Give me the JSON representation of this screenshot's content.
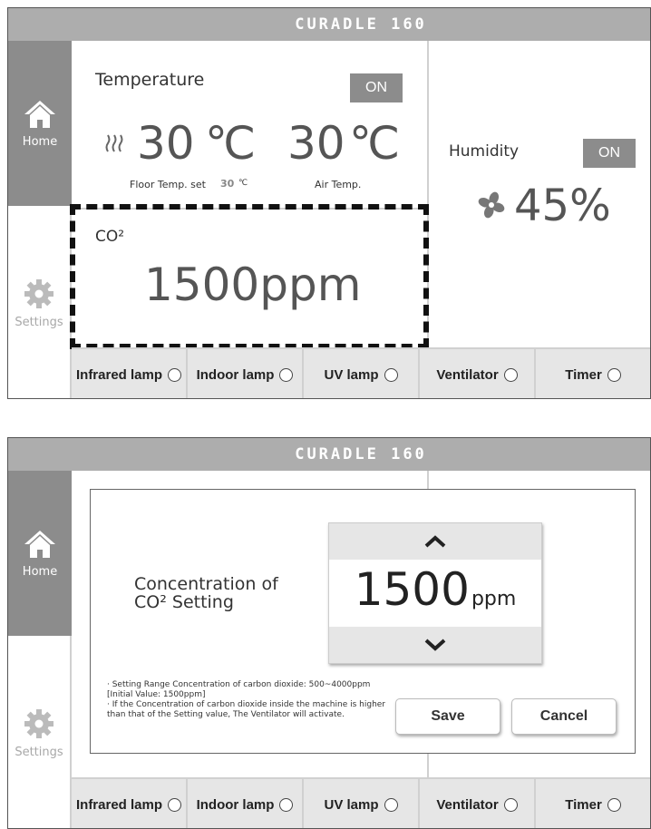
{
  "app_title": "CURADLE 160",
  "nav": {
    "home_label": "Home",
    "settings_label": "Settings"
  },
  "screen1": {
    "temperature": {
      "title": "Temperature",
      "toggle_label": "ON",
      "floor_value": "30",
      "air_value": "30",
      "unit": "℃",
      "floor_label": "Floor Temp. set",
      "floor_set_value": "30",
      "floor_set_unit": "℃",
      "air_label": "Air Temp."
    },
    "humidity": {
      "title": "Humidity",
      "toggle_label": "ON",
      "value": "45%"
    },
    "co2": {
      "title": "CO²",
      "value": "1500ppm"
    }
  },
  "screen2": {
    "dialog": {
      "title_line1": "Concentration of",
      "title_line2": "CO² Setting",
      "value": "1500",
      "unit": "ppm",
      "note_line1": "· Setting Range Concentration of carbon dioxide: 500~4000ppm",
      "note_line2": "[Initial Value: 1500ppm]",
      "note_line3": "· If the Concentration of carbon dioxide inside the machine is higher",
      "note_line4": "than that of the Setting value, The Ventilator will activate.",
      "save_label": "Save",
      "cancel_label": "Cancel"
    }
  },
  "bottom_buttons": [
    "Infrared lamp",
    "Indoor lamp",
    "UV lamp",
    "Ventilator",
    "Timer"
  ],
  "colors": {
    "titlebar": "#adadad",
    "nav_active": "#8c8c8c",
    "toggle": "#8c8c8c",
    "highlight_border": "#111111"
  }
}
